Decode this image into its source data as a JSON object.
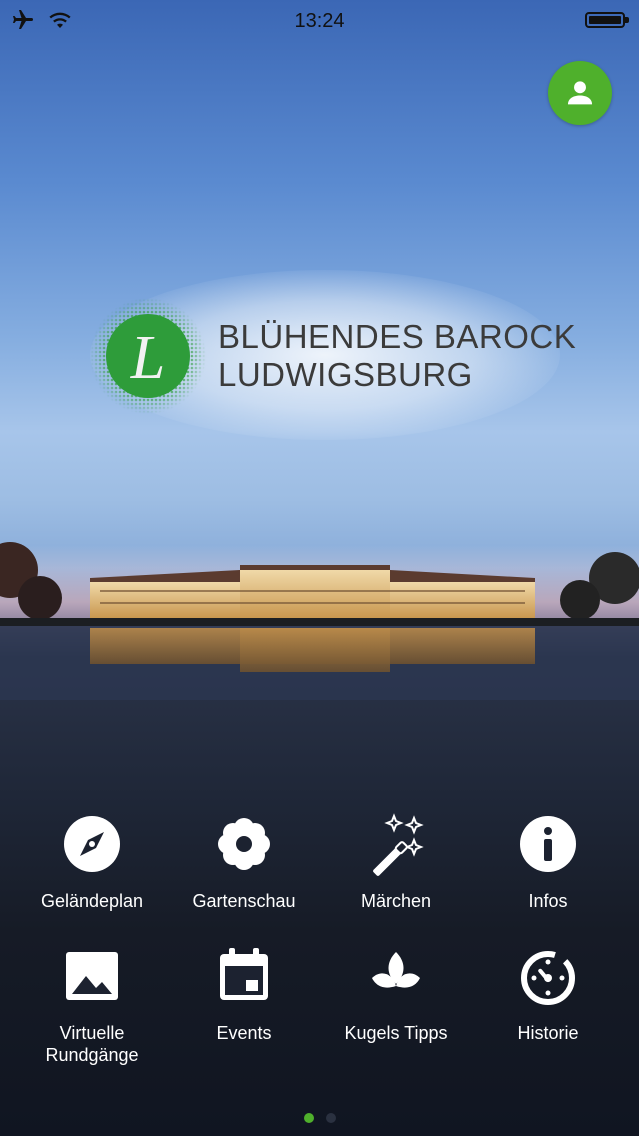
{
  "status_bar": {
    "time": "13:24"
  },
  "logo": {
    "line1": "BLÜHENDES BAROCK",
    "line2": "LUDWIGSBURG",
    "letter": "L"
  },
  "colors": {
    "accent": "#4fb02c",
    "logo_green": "#2e9c3a"
  },
  "menu": [
    {
      "label": "Geländeplan",
      "icon": "compass-icon"
    },
    {
      "label": "Gartenschau",
      "icon": "flower-icon"
    },
    {
      "label": "Märchen",
      "icon": "magic-wand-icon"
    },
    {
      "label": "Infos",
      "icon": "info-icon"
    },
    {
      "label": "Virtuelle\nRundgänge",
      "icon": "image-icon"
    },
    {
      "label": "Events",
      "icon": "calendar-icon"
    },
    {
      "label": "Kugels Tipps",
      "icon": "leaf-icon"
    },
    {
      "label": "Historie",
      "icon": "history-icon"
    }
  ],
  "pager": {
    "pages": 2,
    "current": 1
  }
}
